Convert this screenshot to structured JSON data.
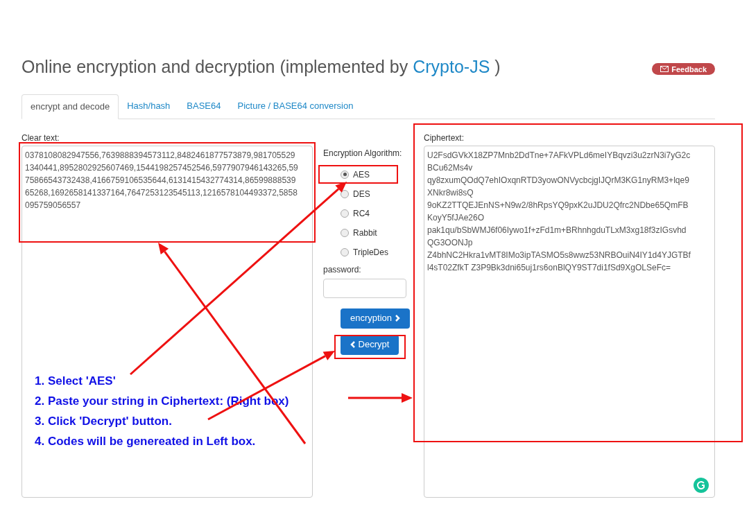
{
  "header": {
    "title": "Online encryption and decryption (implemented by ",
    "link": "Crypto-JS",
    "suffix": " )",
    "feedback": "Feedback"
  },
  "tabs": [
    {
      "label": "encrypt and decode",
      "selected": true
    },
    {
      "label": "Hash/hash",
      "selected": false
    },
    {
      "label": "BASE64",
      "selected": false
    },
    {
      "label": "Picture / BASE64 conversion",
      "selected": false
    }
  ],
  "clear_text": {
    "label": "Clear text:",
    "value": "0378108082947556,7639888394573112,8482461877573879,9817055291340441,8952802925607469,1544198257452546,5977907946143265,5975866543732438,4166759106535644,6131415432774314,8659988853965268,1692658141337164,7647253123545113,1216578104493372,5858095759056557"
  },
  "algorithm": {
    "label": "Encryption Algorithm:",
    "options": [
      {
        "label": "AES",
        "selected": true
      },
      {
        "label": "DES",
        "selected": false
      },
      {
        "label": "RC4",
        "selected": false
      },
      {
        "label": "Rabbit",
        "selected": false
      },
      {
        "label": "TripleDes",
        "selected": false
      }
    ]
  },
  "password": {
    "label": "password:"
  },
  "buttons": {
    "encrypt": "encryption",
    "decrypt": "Decrypt"
  },
  "ciphertext": {
    "label": "Ciphertext:",
    "value": "U2FsdGVkX18ZP7Mnb2DdTne+7AFkVPLd6meIYBqvzi3u2zrN3i7yG2cBCu62Ms4v\nqy8zxumQOdQ7ehIOxqnRTD3yowONVycbcjgIJQrM3KG1nyRM3+lqe9XNkr8wi8sQ\n9oKZ2TTQEJEnNS+N9w2/8hRpsYQ9pxK2uJDU2Qfrc2NDbe65QmFBKoyY5fJAe26O\npak1qu/bSbWMJ6f06Iywo1f+zFd1m+BRhnhgduTLxM3xg18f3zIGsvhdQG3OONJp\nZ4bhNC2Hkra1vMT8IMo3ipTASMO5s8wwz53NRBOuiN4IY1d4YJGTBfl4sT02ZfkT Z3P9Bk3dni65uj1rs6onBlQY9ST7di1fSd9XgOLSeFc="
  },
  "instructions": [
    "1. Select 'AES'",
    "2. Paste your string in Ciphertext: (Right box)",
    "3. Click 'Decrypt' button.",
    "4. Codes will be genereated in Left box."
  ]
}
